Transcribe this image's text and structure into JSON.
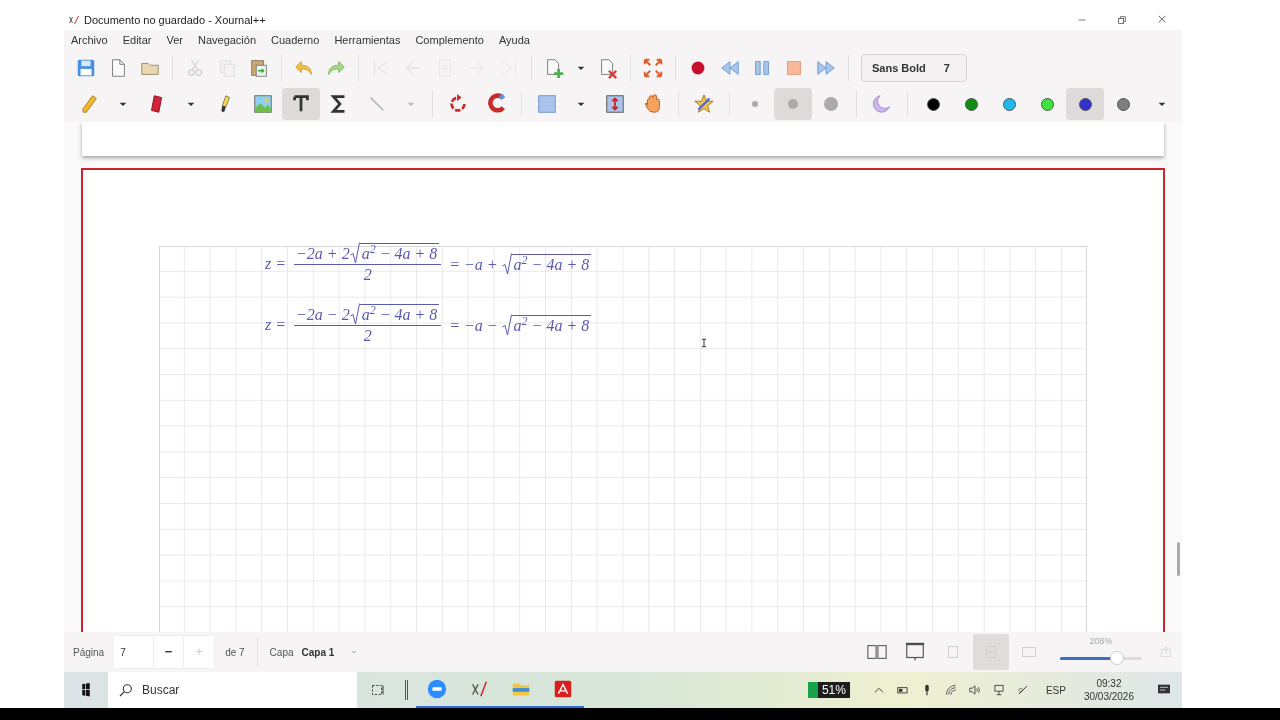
{
  "window": {
    "title": "Documento no guardado - Xournal++"
  },
  "menu": [
    "Archivo",
    "Editar",
    "Ver",
    "Navegación",
    "Cuaderno",
    "Herramientas",
    "Complemento",
    "Ayuda"
  ],
  "toolbar_main": [
    [
      {
        "kind": "save",
        "disabled": false
      },
      {
        "kind": "new",
        "disabled": false
      },
      {
        "kind": "open",
        "disabled": false
      }
    ],
    [
      {
        "kind": "cut",
        "disabled": true
      },
      {
        "kind": "copy",
        "disabled": true
      },
      {
        "kind": "paste",
        "disabled": false
      }
    ],
    [
      {
        "kind": "undo",
        "disabled": false
      },
      {
        "kind": "redo",
        "disabled": false
      }
    ],
    [
      {
        "kind": "first",
        "disabled": true
      },
      {
        "kind": "back",
        "disabled": true
      },
      {
        "kind": "goto",
        "disabled": true
      },
      {
        "kind": "next",
        "disabled": true
      },
      {
        "kind": "last",
        "disabled": true
      }
    ],
    [
      {
        "kind": "add-page",
        "disabled": false
      },
      {
        "kind": "caret",
        "disabled": false
      },
      {
        "kind": "delete-page",
        "disabled": false
      }
    ],
    [
      {
        "kind": "fullscreen",
        "disabled": false
      }
    ],
    [
      {
        "kind": "record",
        "disabled": false
      },
      {
        "kind": "rewind",
        "disabled": false
      },
      {
        "kind": "pause",
        "disabled": false
      },
      {
        "kind": "stop",
        "disabled": false
      },
      {
        "kind": "forward",
        "disabled": false
      }
    ]
  ],
  "font_button": {
    "name": "Sans Bold",
    "size": "7"
  },
  "tools": [
    [
      {
        "kind": "pen",
        "selected": false
      },
      {
        "kind": "caret",
        "selected": false
      },
      {
        "kind": "eraser",
        "selected": false
      },
      {
        "kind": "caret",
        "selected": false
      },
      {
        "kind": "highlighter",
        "selected": false
      },
      {
        "kind": "image",
        "selected": false
      },
      {
        "kind": "text",
        "selected": true
      },
      {
        "kind": "sigma",
        "selected": false
      },
      {
        "kind": "line",
        "selected": false
      },
      {
        "kind": "caret-light",
        "selected": false
      }
    ],
    [
      {
        "kind": "rotate",
        "selected": false
      },
      {
        "kind": "magnet",
        "selected": false
      }
    ],
    [
      {
        "kind": "rect",
        "selected": false
      },
      {
        "kind": "caret",
        "selected": false
      },
      {
        "kind": "vspace",
        "selected": false
      },
      {
        "kind": "hand",
        "selected": false
      }
    ],
    [
      {
        "kind": "star",
        "selected": false
      }
    ],
    [
      {
        "kind": "size-small",
        "selected": false
      },
      {
        "kind": "size-medium",
        "selected": true
      },
      {
        "kind": "size-large",
        "selected": false
      }
    ],
    [
      {
        "kind": "fill",
        "selected": false
      }
    ]
  ],
  "colors": [
    {
      "color": "#000000",
      "selected": false
    },
    {
      "color": "#138a13",
      "selected": false
    },
    {
      "color": "#22b8ea",
      "selected": false
    },
    {
      "color": "#3fe33f",
      "selected": false
    },
    {
      "color": "#3333cc",
      "selected": true
    },
    {
      "color": "#7f7f7f",
      "selected": false
    }
  ],
  "equations": [
    {
      "lhs": "z =",
      "numerator": "−2a + 2",
      "radicand": "a$^{2}$ − 4a + 8",
      "denominator": "2",
      "rhs": "= −a +",
      "rhs_radicand": "a$^{2}$ − 4a + 8"
    },
    {
      "lhs": "z =",
      "numerator": "−2a − 2",
      "radicand": "a$^{2}$ − 4a + 8",
      "denominator": "2",
      "rhs": "= −a −",
      "rhs_radicand": "a$^{2}$ − 4a + 8"
    }
  ],
  "status_bar": {
    "page_label": "Página",
    "page_value": "7",
    "minus": "−",
    "plus": "+",
    "page_count": "de 7",
    "layer_label": "Capa",
    "layer_value": "Capa 1",
    "zoom": "208%",
    "zoom_slider": {
      "level": 0.7
    },
    "views": [
      {
        "kind": "dual",
        "selected": false
      },
      {
        "kind": "presentation",
        "selected": false
      },
      {
        "kind": "zoom-fit",
        "selected": false
      },
      {
        "kind": "zoom-width",
        "selected": true
      },
      {
        "kind": "zoom-page",
        "selected": false
      }
    ]
  },
  "taskbar": {
    "search_placeholder": "Buscar",
    "battery": "51%",
    "language": "ESP",
    "time": "09:32",
    "date": "30/03/2026"
  }
}
